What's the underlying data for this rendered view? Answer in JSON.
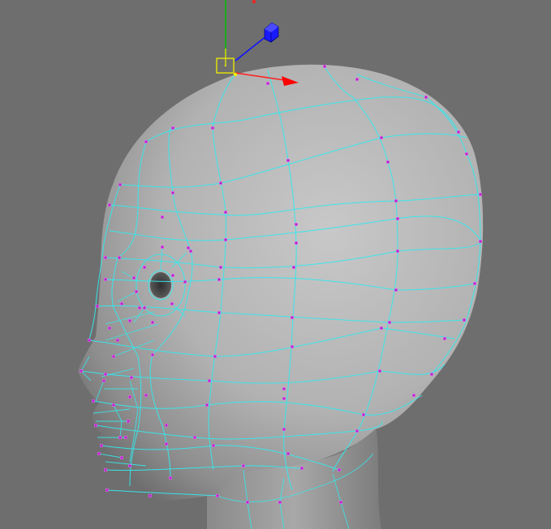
{
  "viewport": {
    "background": "#6e6e6e",
    "mesh_shade_light": "#c4c4c4",
    "mesh_shade_dark": "#777777",
    "wire_color": "#35e8ec",
    "vertex_color": "#b81cc8",
    "selection_color": "#f0f000"
  },
  "manipulator": {
    "x_axis_color": "#ff0000",
    "y_axis_color": "#00c000",
    "z_axis_color": "#1010ff",
    "icons": [
      "move-x-arrow-icon",
      "move-y-axis-icon",
      "move-z-cube-icon",
      "pivot-handle-icon"
    ]
  }
}
